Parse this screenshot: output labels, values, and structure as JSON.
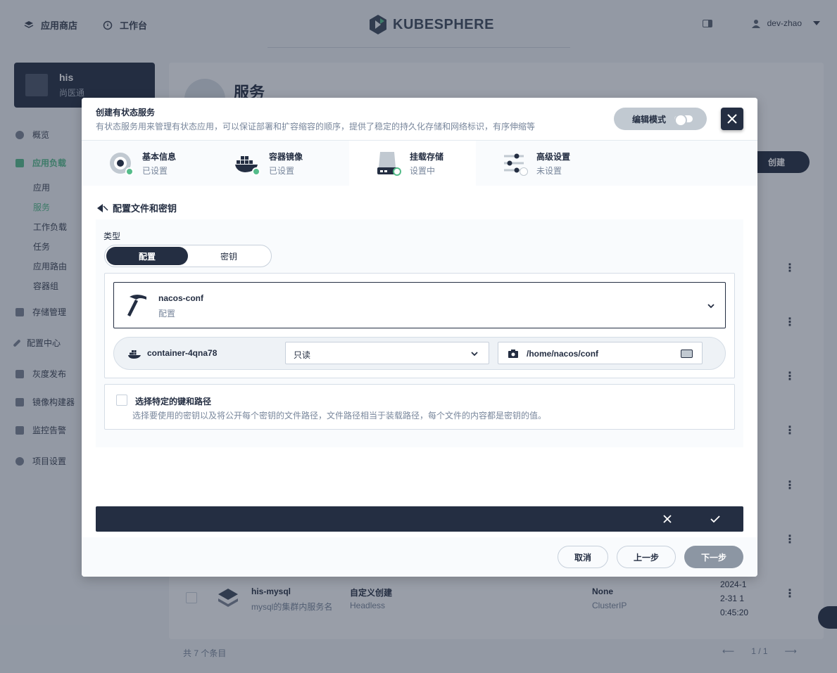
{
  "topbar": {
    "app_store": "应用商店",
    "workbench": "工作台",
    "brand": "KUBESPHERE",
    "user": "dev-zhao"
  },
  "project": {
    "name": "his",
    "alias": "尚医通"
  },
  "sidebar": {
    "items": [
      {
        "label": "概览"
      },
      {
        "label": "应用负载"
      },
      {
        "label": "存储管理"
      },
      {
        "label": "配置中心"
      },
      {
        "label": "灰度发布"
      },
      {
        "label": "镜像构建器"
      },
      {
        "label": "监控告警"
      },
      {
        "label": "项目设置"
      }
    ],
    "sub_items": [
      {
        "label": "应用"
      },
      {
        "label": "服务"
      },
      {
        "label": "工作负载"
      },
      {
        "label": "任务"
      },
      {
        "label": "应用路由"
      },
      {
        "label": "容器组"
      }
    ]
  },
  "main": {
    "title": "服务",
    "create_label": "创建",
    "row": {
      "name": "his-mysql",
      "desc": "mysql的集群内服务名",
      "create_type": "自定义创建",
      "service_type": "Headless",
      "external": "None",
      "access": "ClusterIP",
      "time_l1": "2024-1",
      "time_l2": "2-31 1",
      "time_l3": "0:45:20"
    },
    "total": "共 7 个条目",
    "page": "1 / 1"
  },
  "modal": {
    "title": "创建有状态服务",
    "description": "有状态服务用来管理有状态应用，可以保证部署和扩容缩容的顺序，提供了稳定的持久化存储和网络标识，有序伸缩等",
    "edit_mode": "编辑模式",
    "steps": [
      {
        "name": "基本信息",
        "status": "已设置"
      },
      {
        "name": "容器镜像",
        "status": "已设置"
      },
      {
        "name": "挂载存储",
        "status": "设置中"
      },
      {
        "name": "高级设置",
        "status": "未设置"
      }
    ],
    "back_label": "配置文件和密钥",
    "type_label": "类型",
    "type_options": [
      "配置",
      "密钥"
    ],
    "volume": {
      "name": "nacos-conf",
      "type": "配置"
    },
    "mount": {
      "container": "container-4qna78",
      "mode": "只读",
      "path": "/home/nacos/conf"
    },
    "specific_keys": {
      "title": "选择特定的键和路径",
      "description": "选择要使用的密钥以及将公开每个密钥的文件路径，文件路径相当于装载路径，每个文件的内容都是密钥的值。"
    },
    "footer": {
      "cancel": "取消",
      "prev": "上一步",
      "next": "下一步"
    }
  },
  "colors": {
    "dark": "#242e42",
    "accent": "#55bc8a",
    "muted": "#79879c"
  }
}
